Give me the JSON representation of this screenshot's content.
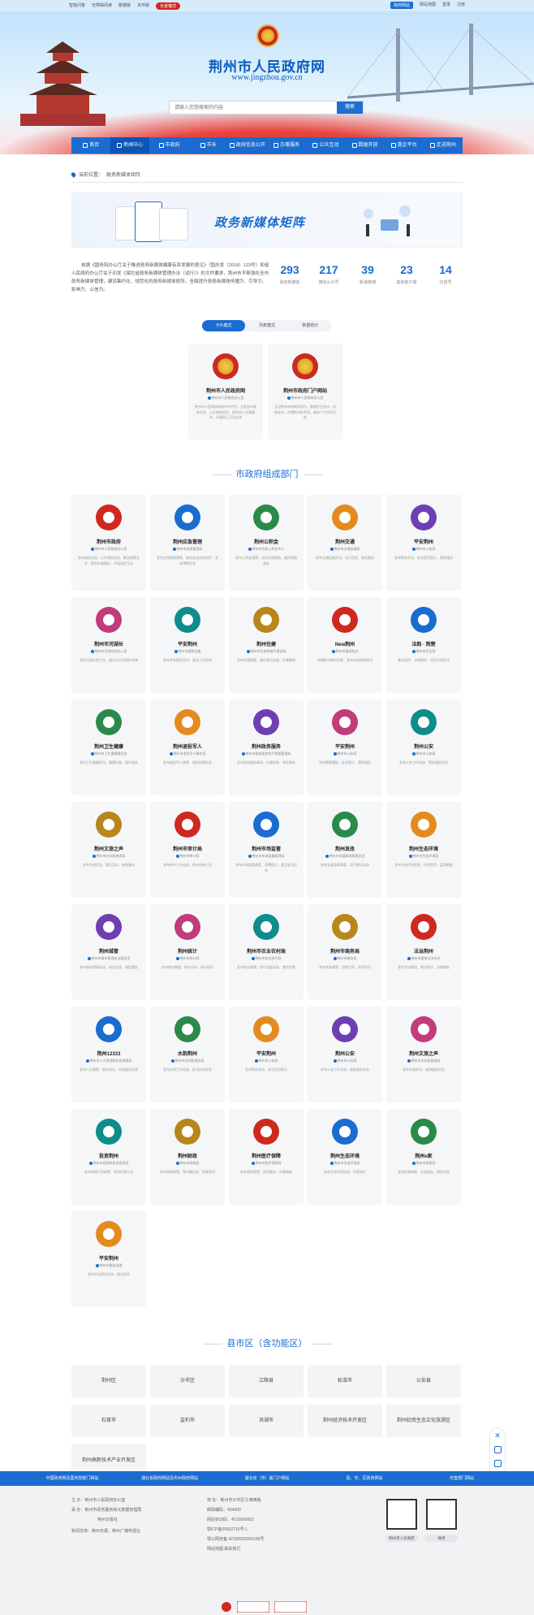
{
  "topbar": {
    "left": [
      "智能问答",
      "无障碍阅读",
      "繁體版",
      "关怀版"
    ],
    "elder_mode": "长者模式",
    "right": [
      "政府网站",
      "网站地图",
      "登录",
      "注册"
    ]
  },
  "header": {
    "site_title": "荆州市人民政府网",
    "site_url": "www.jingzhou.gov.cn",
    "search_placeholder": "请输入您想搜索的内容",
    "search_button": "搜索"
  },
  "nav": [
    "首页",
    "新闻中心",
    "市政府",
    "市长",
    "政府信息公开",
    "办事服务",
    "公众互动",
    "数据开放",
    "惠企平台",
    "走进荆州"
  ],
  "breadcrumb": {
    "label": "当前位置：",
    "value": "政务新媒体矩阵"
  },
  "banner": {
    "title": "政务新媒体矩阵"
  },
  "intro": "依据《国务院办公厅关于推进政务新媒体健康有序发展的意见》（国办发〔2018〕123号）和省人民政府办公厅关于印发《湖北省政务新媒体管理办法（试行）》的文件要求，荆州市不断强化全市政务新媒体管理，建设集约化、规范化的政务新媒体矩阵，全面提升政务新媒体传播力、引导力、影响力、公信力。",
  "stats": [
    {
      "number": "293",
      "label": "政务新媒体"
    },
    {
      "number": "217",
      "label": "微信公众号"
    },
    {
      "number": "39",
      "label": "新浪微博"
    },
    {
      "number": "23",
      "label": "其他客户端"
    },
    {
      "number": "14",
      "label": "抖音号"
    }
  ],
  "tabs": [
    "卡片模式",
    "列表模式",
    "数据统计"
  ],
  "top_cards": [
    {
      "name": "荆州市人民政府网",
      "owner": "荆州市人民政府办公室",
      "desc": "荆州市人民政府网络发布平台，主要发布政务信息、公开政府信息、提供网上办事服务、开展网上互动交流"
    },
    {
      "name": "荆州市政府门户网站",
      "owner": "荆州市人民政府办公室",
      "desc": "立足荆州本地新闻资讯，聚焦民生热点，权威发布，传播荆州好声音，服务广大市民百姓"
    }
  ],
  "section_departments": "市政府组成部门",
  "departments": [
    {
      "name": "荆州市政府",
      "owner": "荆州市人民政府办公室",
      "desc": "发布政务信息、公开政府信息、解读政策文件、提供办事服务、开展政民互动"
    },
    {
      "name": "荆州应急管理",
      "owner": "荆州市应急管理局",
      "desc": "宣传应急管理政策、普及安全应急知识、发布预警信息"
    },
    {
      "name": "荆州公积金",
      "owner": "荆州市住房公积金中心",
      "desc": "发布公积金政策、业务办理指南、缴存提取服务"
    },
    {
      "name": "荆州交通",
      "owner": "荆州市交通运输局",
      "desc": "发布交通运输资讯、出行信息、路况服务"
    },
    {
      "name": "平安荆州",
      "owner": "荆州市公安局",
      "desc": "发布警务资讯、安全防范提示、便民服务"
    },
    {
      "name": "荆州市河湖长",
      "owner": "荆州市河湖长制办公室",
      "desc": "宣传河湖长制工作、展示水生态保护成果"
    },
    {
      "name": "平安荆州",
      "owner": "荆州市委政法委",
      "desc": "发布平安建设资讯、政法工作动态"
    },
    {
      "name": "荆州住建",
      "owner": "荆州市住房和城乡建设局",
      "desc": "发布住建政策、城市建设动态、办事指南"
    },
    {
      "name": "New荆州",
      "owner": "荆州市委网信办",
      "desc": "传播荆州城市形象、发布本地新闻资讯"
    },
    {
      "name": "法韵 · 荆楚",
      "owner": "荆州市司法局",
      "desc": "普法宣传、法律服务、司法行政资讯"
    },
    {
      "name": "荆州卫生健康",
      "owner": "荆州市卫生健康委员会",
      "desc": "发布卫生健康资讯、健康科普、医疗服务"
    },
    {
      "name": "荆州退役军人",
      "owner": "荆州市退役军人事务局",
      "desc": "发布退役军人政策、服务保障信息"
    },
    {
      "name": "荆州政务服务",
      "owner": "荆州市政务服务和大数据管理局",
      "desc": "发布政务服务事项、办事指南、便民服务"
    },
    {
      "name": "平安荆州",
      "owner": "荆州市公安局",
      "desc": "发布警情通报、安全提示、便民服务"
    },
    {
      "name": "荆州公安",
      "owner": "荆州市公安局",
      "desc": "发布公安工作动态、警务服务信息"
    },
    {
      "name": "荆州文旅之声",
      "owner": "荆州市文化和旅游局",
      "desc": "发布文旅资讯、景区活动、旅游服务"
    },
    {
      "name": "荆州市审计局",
      "owner": "荆州市审计局",
      "desc": "发布审计工作动态、审计结果公告"
    },
    {
      "name": "荆州市场监管",
      "owner": "荆州市市场监督管理局",
      "desc": "发布市场监管政策、消费提示、食品安全信息"
    },
    {
      "name": "荆州发改",
      "owner": "荆州市发展和改革委员会",
      "desc": "发布发展改革政策、项目建设动态"
    },
    {
      "name": "荆州生态环境",
      "owner": "荆州市生态环境局",
      "desc": "发布生态环境信息、环保宣传、监测数据"
    },
    {
      "name": "荆州城管",
      "owner": "荆州市城市管理执法委员会",
      "desc": "发布城市管理动态、执法信息、便民服务"
    },
    {
      "name": "荆州统计",
      "owner": "荆州市统计局",
      "desc": "发布统计数据、统计分析、统计知识"
    },
    {
      "name": "荆州市农业农村局",
      "owner": "荆州市农业农村局",
      "desc": "发布农业政策、农村发展动态、惠农信息"
    },
    {
      "name": "荆州市商务局",
      "owner": "荆州市商务局",
      "desc": "发布商务政策、招商引资、外贸资讯"
    },
    {
      "name": "法治荆州",
      "owner": "荆州市委依法治市办",
      "desc": "宣传法治建设、普法知识、法律服务"
    },
    {
      "name": "荆州12333",
      "owner": "荆州市人力资源和社会保障局",
      "desc": "发布人社政策、就业创业、社保服务信息"
    },
    {
      "name": "水韵荆州",
      "owner": "荆州市水利和湖泊局",
      "desc": "发布水利工作动态、防汛抗旱信息"
    },
    {
      "name": "平安荆州",
      "owner": "荆州市公安局",
      "desc": "发布警务资讯、安全防范提示"
    },
    {
      "name": "荆州公安",
      "owner": "荆州市公安局",
      "desc": "发布公安工作动态、便民服务信息"
    },
    {
      "name": "荆州文旅之声",
      "owner": "荆州市文化和旅游局",
      "desc": "发布文旅资讯、旅游服务信息"
    },
    {
      "name": "投资荆州",
      "owner": "荆州市招商和投资促进局",
      "desc": "发布招商引资政策、投资环境介绍"
    },
    {
      "name": "荆州财政",
      "owner": "荆州市财政局",
      "desc": "发布财政政策、预决算信息、财政资讯"
    },
    {
      "name": "荆州医疗保障",
      "owner": "荆州市医疗保障局",
      "desc": "发布医保政策、医保服务、办事指南"
    },
    {
      "name": "荆州生态环境",
      "owner": "荆州市生态环境局",
      "desc": "发布生态环境动态、环保知识"
    },
    {
      "name": "荆州e家",
      "owner": "荆州市民政局",
      "desc": "发布民政政策、社会服务、便民信息"
    },
    {
      "name": "平安荆州",
      "owner": "荆州市委政法委",
      "desc": "发布平安建设动态、政法宣传"
    }
  ],
  "section_counties": "县市区（含功能区）",
  "counties": [
    "荆州区",
    "沙市区",
    "江陵县",
    "松滋市",
    "公安县",
    "石首市",
    "监利市",
    "洪湖市",
    "荆州经济技术开发区",
    "荆州纪南生态文化旅游区",
    "荆州高新技术产业开发区"
  ],
  "footer_links": [
    "中国政府网及国务院部门网站",
    "湖北省政府网站及市州政府网站",
    "湖北省（市）属门户网站",
    "县、市、区政府网站",
    "市直部门网站"
  ],
  "footer": {
    "host_label": "主  办：",
    "host": "荆州市人民政府办公室",
    "undertake_label": "承  办：",
    "undertake": "荆州市政务服务和大数据管理局",
    "maintain": "荆州日报社",
    "support_label": "新闻支持：",
    "support": "荆州日报、荆州广播电视台",
    "address_label": "地  址：",
    "address": "荆州市沙市区江津西路",
    "code_label": "网站标识码：",
    "code": "4210000002",
    "phone_label": "邮政编码：",
    "phone": "434000",
    "icp": "鄂ICP备05002710号-1",
    "police": "鄂公网安备 42100202000199号",
    "sitemap": "网站地图  联系我们",
    "qr1": "荆州市人民政府",
    "qr2": "微博"
  },
  "side_icons": [
    "close-icon",
    "chat-icon",
    "document-icon",
    "mobile-icon",
    "message-icon",
    "headset-icon",
    "back-to-top-icon"
  ]
}
